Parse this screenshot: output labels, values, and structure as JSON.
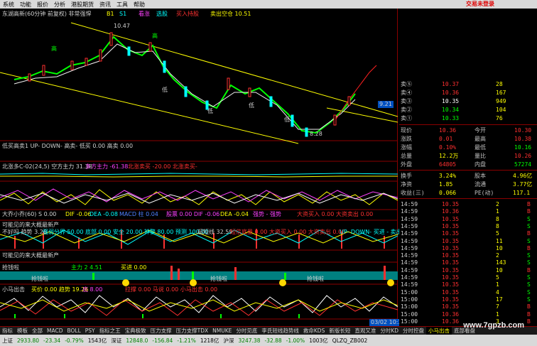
{
  "menu": {
    "items": [
      "系统",
      "功能",
      "报价",
      "分析",
      "港股期货",
      "资讯",
      "工具",
      "帮助"
    ],
    "trade": "交易未登录"
  },
  "chart": {
    "title": "东湖高新(60分钟 前复权) 非常强悍",
    "signals": [
      "B1",
      "S1",
      "看涨",
      "选股",
      "买入持股",
      "卖出空仓 10.51"
    ],
    "price_high": "10.47",
    "price_low": "8.28",
    "price_right": "9.21",
    "markers": [
      "高",
      "高",
      "低",
      "低",
      "低",
      "低"
    ],
    "panels": {
      "p1": "低买高卖1 UP- DOWN- 高卖- 低买 0.00 高卖 0.00",
      "p2a": "北涨多C-02(24,5) 空方主力 31.38",
      "p2b": "多方主力 -61.38",
      "p2c": "北涨卖买 -20.00 北涨卖买-",
      "p3a": "大乔小乔(60) S 0.00",
      "p3b": "DIF -0.06",
      "p3c": "DEA -0.08",
      "p3d": "MACD 柱 0.04",
      "p3e": "股票 0.00 DIF -0.06",
      "p3f": "DEA -0.04",
      "p3g": "强势 - 强势",
      "p3h": "大资买入 0.00 大资卖出 0.00",
      "p4": "可能见的来大概最新产",
      "p5a": "不好吗 趋势 3.26",
      "p5b": "强弱分界 50.00 底部 0.00 安全 20.00 神警 80.00 预测 100.00",
      "p5c": "超短线 32.59",
      "p5d": "短信底量 0.00 大资买入 0.00 大资卖出 0.00",
      "p5e": "UP- DOWN- 买进 - 卖出",
      "p6": "可能见的来大概最新产",
      "p7a": "抢钱啦",
      "p7b": "主力 2 4.51",
      "p7c": "买进 0.00",
      "p7d": "抢钱啦",
      "p7e": "抢钱啦",
      "p7f": "抢钱啦",
      "p8a": "小马出击",
      "p8b": "买价 0.00 趋势 19.26",
      "p8c": "底 8.00",
      "p8d": "拉撑 0.00 马说 0.00 小马出击 0.00",
      "time_axis": "03/02 10:30",
      "period": "60分钟"
    }
  },
  "quote": {
    "order_book": [
      {
        "label": "卖⑤",
        "price": "10.37",
        "vol": "28"
      },
      {
        "label": "卖④",
        "price": "10.36",
        "vol": "167"
      },
      {
        "label": "卖③",
        "price": "10.35",
        "vol": "949"
      },
      {
        "label": "卖②",
        "price": "10.34",
        "vol": "104"
      },
      {
        "label": "卖①",
        "price": "10.33",
        "vol": "76"
      }
    ],
    "stats": [
      {
        "k1": "现价",
        "v1": "10.36",
        "k2": "今开",
        "v2": "10.30"
      },
      {
        "k1": "涨跌",
        "v1": "0.01",
        "k2": "最高",
        "v2": "10.38"
      },
      {
        "k1": "涨幅",
        "v1": "0.10%",
        "k2": "最低",
        "v2": "10.16"
      },
      {
        "k1": "总量",
        "v1": "12.2万",
        "k2": "量比",
        "v2": "10.26"
      },
      {
        "k1": "外盘",
        "v1": "64805",
        "k2": "内盘",
        "v2": "57274"
      },
      {
        "k1": "换手",
        "v1": "3.24%",
        "k2": "股本",
        "v2": "4.96亿"
      },
      {
        "k1": "净资",
        "v1": "1.85",
        "k2": "流通",
        "v2": "3.77亿"
      },
      {
        "k1": "收益(三)",
        "v1": "0.066",
        "k2": "PE(动)",
        "v2": "117.1"
      }
    ],
    "ticks": [
      {
        "t": "14:59",
        "p": "10.35",
        "v": "2",
        "d": "B"
      },
      {
        "t": "14:59",
        "p": "10.36",
        "v": "1",
        "d": "B"
      },
      {
        "t": "14:59",
        "p": "10.35",
        "v": "8",
        "d": "S"
      },
      {
        "t": "14:59",
        "p": "10.35",
        "v": "8",
        "d": "S"
      },
      {
        "t": "14:59",
        "p": "10.35",
        "v": "5",
        "d": "B"
      },
      {
        "t": "14:59",
        "p": "10.35",
        "v": "11",
        "d": "S"
      },
      {
        "t": "14:59",
        "p": "10.35",
        "v": "10",
        "d": "B"
      },
      {
        "t": "14:59",
        "p": "10.35",
        "v": "2",
        "d": "S"
      },
      {
        "t": "14:59",
        "p": "10.35",
        "v": "143",
        "d": "S"
      },
      {
        "t": "14:59",
        "p": "10.35",
        "v": "10",
        "d": "B"
      },
      {
        "t": "14:59",
        "p": "10.35",
        "v": "5",
        "d": "S"
      },
      {
        "t": "14:59",
        "p": "10.35",
        "v": "1",
        "d": "S"
      },
      {
        "t": "15:00",
        "p": "10.35",
        "v": "4",
        "d": "S"
      },
      {
        "t": "15:00",
        "p": "10.35",
        "v": "17",
        "d": "S"
      },
      {
        "t": "15:00",
        "p": "10.35",
        "v": "7",
        "d": "B"
      },
      {
        "t": "15:00",
        "p": "10.36",
        "v": "1",
        "d": "B"
      },
      {
        "t": "15:00",
        "p": "10.36",
        "v": "3",
        "d": "B"
      }
    ]
  },
  "tabs": [
    "指标",
    "模板",
    "全部",
    "MACD",
    "BOLL",
    "PSY",
    "指标之王",
    "宝典极致",
    "压力支撑",
    "压力支撑TDX",
    "NMUKE",
    "分时见底",
    "李氏短线趋势线",
    "救命KDS",
    "新版长短",
    "直观又准",
    "分时KD",
    "分时控盘",
    "小马出击",
    "底部看盘"
  ],
  "active_tab": 18,
  "status": {
    "sh_label": "上证",
    "sh_value": "2933.80",
    "sh_change": "-23.34",
    "sh_pct": "-0.79%",
    "sh_vol": "1543亿",
    "sz_label": "深证",
    "sz_value": "12848.0",
    "sz_change": "-156.84",
    "sz_pct": "-1.21%",
    "sz_vol": "1218亿",
    "hs_label": "沪深",
    "hs_value": "3247.38",
    "hs_change": "-32.88",
    "hs_pct": "-1.00%",
    "hs_vol": "1003亿",
    "extra": "QLZQ_ZB002",
    "watermark": "www.7gpzb.com"
  }
}
